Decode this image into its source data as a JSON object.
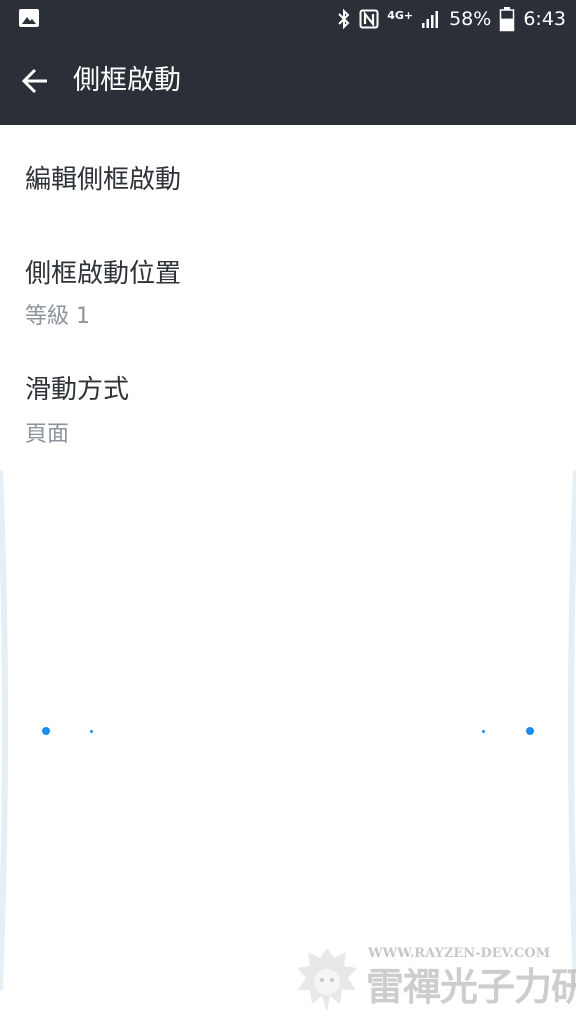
{
  "status_bar": {
    "icons": [
      "gallery-icon",
      "bluetooth-icon",
      "nfc-icon",
      "signal-icon",
      "battery-icon"
    ],
    "network": "4G+",
    "battery": "58%",
    "battery_level": 0.58,
    "time": "6:43"
  },
  "app_bar": {
    "back_icon": "arrow-left-icon",
    "title": "側框啟動"
  },
  "settings": {
    "items": [
      {
        "title": "編輯側框啟動",
        "summary": ""
      },
      {
        "title": "側框啟動位置",
        "summary": "等級 1"
      },
      {
        "title": "滑動方式",
        "summary": "頁面"
      }
    ]
  },
  "colors": {
    "bar_background": "#2b2f37",
    "title_text": "#2f3338",
    "summary_text": "#8d949c",
    "accent_dot": "#1a8cf0"
  },
  "watermark": {
    "url": "WWW.RAYZEN-DEV.COM",
    "name": "雷禪光子力研究所"
  }
}
